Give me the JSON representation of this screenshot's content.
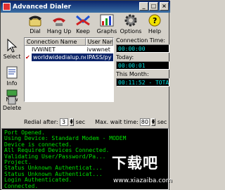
{
  "window": {
    "title": "Advanced Dialer"
  },
  "toolbar": {
    "buttons": [
      {
        "label": "Dial",
        "icon": "phone-icon"
      },
      {
        "label": "Hang Up",
        "icon": "hangup-phone-icon"
      },
      {
        "label": "Keep",
        "icon": "keep-plug-icon"
      },
      {
        "label": "Graphs",
        "icon": "graph-icon"
      },
      {
        "label": "Options",
        "icon": "gear-icon"
      },
      {
        "label": "Help",
        "icon": "help-icon"
      }
    ]
  },
  "sidebar": {
    "buttons": [
      {
        "label": "Select",
        "icon": "select-arrow-icon"
      },
      {
        "label": "Info",
        "icon": "info-icon"
      },
      {
        "label": "New",
        "icon": "new-connection-icon"
      },
      {
        "label": "Delete",
        "icon": "delete-icon"
      }
    ]
  },
  "connections": {
    "columns": [
      "Connection Name",
      "User Nam"
    ],
    "rows": [
      {
        "name": "IVWiNET",
        "user": "ivwwnet",
        "checked": false,
        "selected": false
      },
      {
        "name": "worldwidedialup.net",
        "user": "IPASS/py",
        "checked": true,
        "selected": true
      }
    ]
  },
  "timers": {
    "connection_label": "Connection Time:",
    "connection_value": "00:00:00",
    "today_label": "Today:",
    "today_value": "00:00:01",
    "month_label": "This Month:",
    "month_value": "00:11:52 - TOTAL"
  },
  "redial": {
    "label": "Redial after:",
    "value": "3",
    "unit": "sec",
    "max_label": "Max. wait time:",
    "max_value": "80",
    "max_unit": "sec"
  },
  "log": {
    "lines": [
      "Port Opened.",
      "Using Device: Standard Modem - MODEM",
      "Device is connected.",
      "All Required Devices Connected.",
      "Validating User/Password/Pa...",
      "Project.",
      "Status Unknown Authenticat...",
      "Status Unknown Authenticat...",
      "Login Authenticated.",
      "Connected."
    ]
  },
  "watermark": {
    "text": "下载吧",
    "url": "www.xiazaiba.com"
  }
}
